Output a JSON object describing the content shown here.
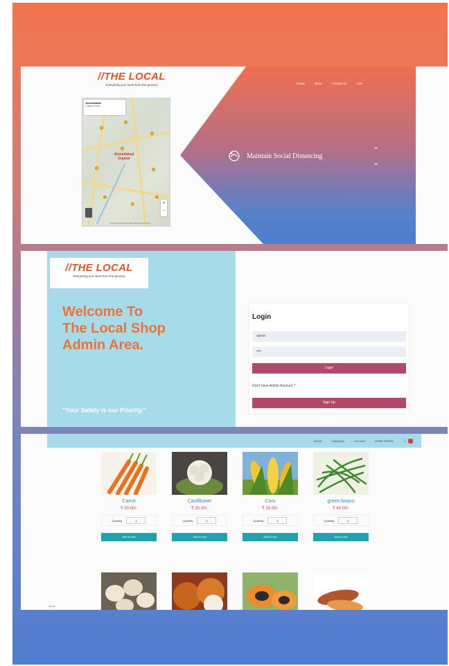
{
  "brand": {
    "name": "//THE LOCAL",
    "tagline": "Everything you need from the grocery"
  },
  "landing": {
    "nav": [
      "Home",
      "Store",
      "Contact us",
      "Cart"
    ],
    "hero_text": "Maintain Social Distancing",
    "map": {
      "card_title": "Ahmedabad",
      "card_subtitle": "Gujarat, India",
      "label": "Ahmedabad Gujarat",
      "footer": "Keyboard shortcuts  Map data  Terms of Use"
    }
  },
  "admin": {
    "logo_tagline": "Everything you need from the grocery",
    "welcome": "Welcome To The Local Shop Admin Area.",
    "quote": "\"Your Safety is our Priority.\"",
    "login": {
      "title": "Login",
      "username_value": "admin",
      "password_value": "••••",
      "login_button": "Login",
      "signup_question": "Don't have Admin Account ?",
      "signup_button": "Sign Up"
    }
  },
  "shop": {
    "nav": [
      "Home",
      "Category",
      "Account",
      "Order History"
    ],
    "cart_count": "0",
    "products": [
      {
        "name": "Carrot",
        "price": "₹ 30.00/-"
      },
      {
        "name": "Cauliflower",
        "price": "₹ 30.00/-"
      },
      {
        "name": "Corn",
        "price": "₹ 15.00/-"
      },
      {
        "name": "green beans",
        "price": "₹ 60.00/-"
      }
    ],
    "quantity_label": "Quantity",
    "quantity_value": "1",
    "add_button": "Add to cart",
    "corner_note": "Go to"
  },
  "colors": {
    "brand_orange": "#e0532a",
    "admin_panel": "#a8dbe9",
    "welcome_orange": "#ec7335",
    "login_button": "#b34968",
    "add_button": "#1fa3b0",
    "price_red": "#e0443a"
  }
}
